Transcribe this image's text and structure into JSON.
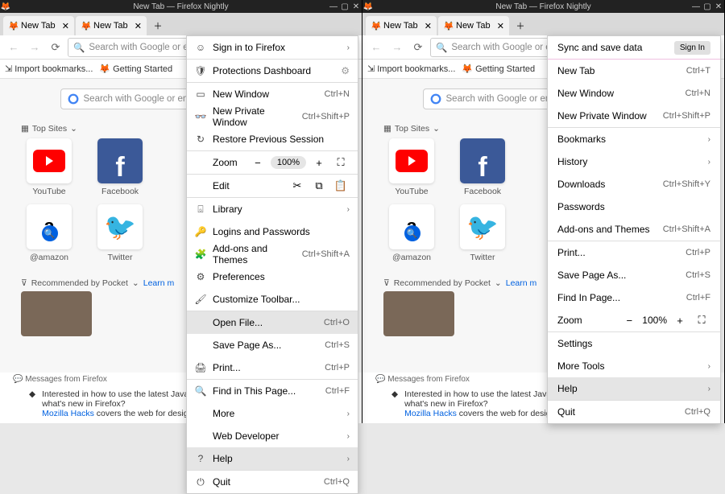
{
  "window": {
    "title": "New Tab — Firefox Nightly"
  },
  "tabs": [
    {
      "label": "New Tab"
    },
    {
      "label": "New Tab"
    }
  ],
  "toolbar": {
    "url_placeholder": "Search with Google or enter address"
  },
  "bookmarks": {
    "import": "Import bookmarks...",
    "getting_started": "Getting Started"
  },
  "newtab": {
    "search_placeholder": "Search with Google or enter address",
    "topsites_label": "Top Sites",
    "tiles": [
      {
        "name": "YouTube"
      },
      {
        "name": "Facebook"
      },
      {
        "name": "@amazon"
      },
      {
        "name": "Twitter"
      }
    ],
    "pocket_label": "Recommended by Pocket",
    "learn_more": "Learn m",
    "messages_label": "Messages from Firefox",
    "article_text": "Interested in how to use the latest JavaScript or CSS features? Want to know what's new in Firefox?",
    "article_link": "Mozilla Hacks",
    "article_tail": " covers the web for designers and devs."
  },
  "menu_old": {
    "sign_in": "Sign in to Firefox",
    "protections": "Protections Dashboard",
    "new_window": {
      "label": "New Window",
      "shortcut": "Ctrl+N"
    },
    "new_private": {
      "label": "New Private Window",
      "shortcut": "Ctrl+Shift+P"
    },
    "restore": "Restore Previous Session",
    "zoom_label": "Zoom",
    "zoom_pct": "100%",
    "edit_label": "Edit",
    "library": "Library",
    "logins": "Logins and Passwords",
    "addons": {
      "label": "Add-ons and Themes",
      "shortcut": "Ctrl+Shift+A"
    },
    "prefs": "Preferences",
    "customize": "Customize Toolbar...",
    "open_file": {
      "label": "Open File...",
      "shortcut": "Ctrl+O"
    },
    "save_as": {
      "label": "Save Page As...",
      "shortcut": "Ctrl+S"
    },
    "print": {
      "label": "Print...",
      "shortcut": "Ctrl+P"
    },
    "find": {
      "label": "Find in This Page...",
      "shortcut": "Ctrl+F"
    },
    "more": "More",
    "web_dev": "Web Developer",
    "help": "Help",
    "quit": {
      "label": "Quit",
      "shortcut": "Ctrl+Q"
    }
  },
  "menu_new": {
    "sync": "Sync and save data",
    "sign_in_btn": "Sign In",
    "new_tab": {
      "label": "New Tab",
      "shortcut": "Ctrl+T"
    },
    "new_window": {
      "label": "New Window",
      "shortcut": "Ctrl+N"
    },
    "new_private": {
      "label": "New Private Window",
      "shortcut": "Ctrl+Shift+P"
    },
    "bookmarks": "Bookmarks",
    "history": "History",
    "downloads": {
      "label": "Downloads",
      "shortcut": "Ctrl+Shift+Y"
    },
    "passwords": "Passwords",
    "addons": {
      "label": "Add-ons and Themes",
      "shortcut": "Ctrl+Shift+A"
    },
    "print": {
      "label": "Print...",
      "shortcut": "Ctrl+P"
    },
    "save_as": {
      "label": "Save Page As...",
      "shortcut": "Ctrl+S"
    },
    "find": {
      "label": "Find In Page...",
      "shortcut": "Ctrl+F"
    },
    "zoom_label": "Zoom",
    "zoom_pct": "100%",
    "settings": "Settings",
    "more_tools": "More Tools",
    "help": "Help",
    "quit": {
      "label": "Quit",
      "shortcut": "Ctrl+Q"
    }
  }
}
